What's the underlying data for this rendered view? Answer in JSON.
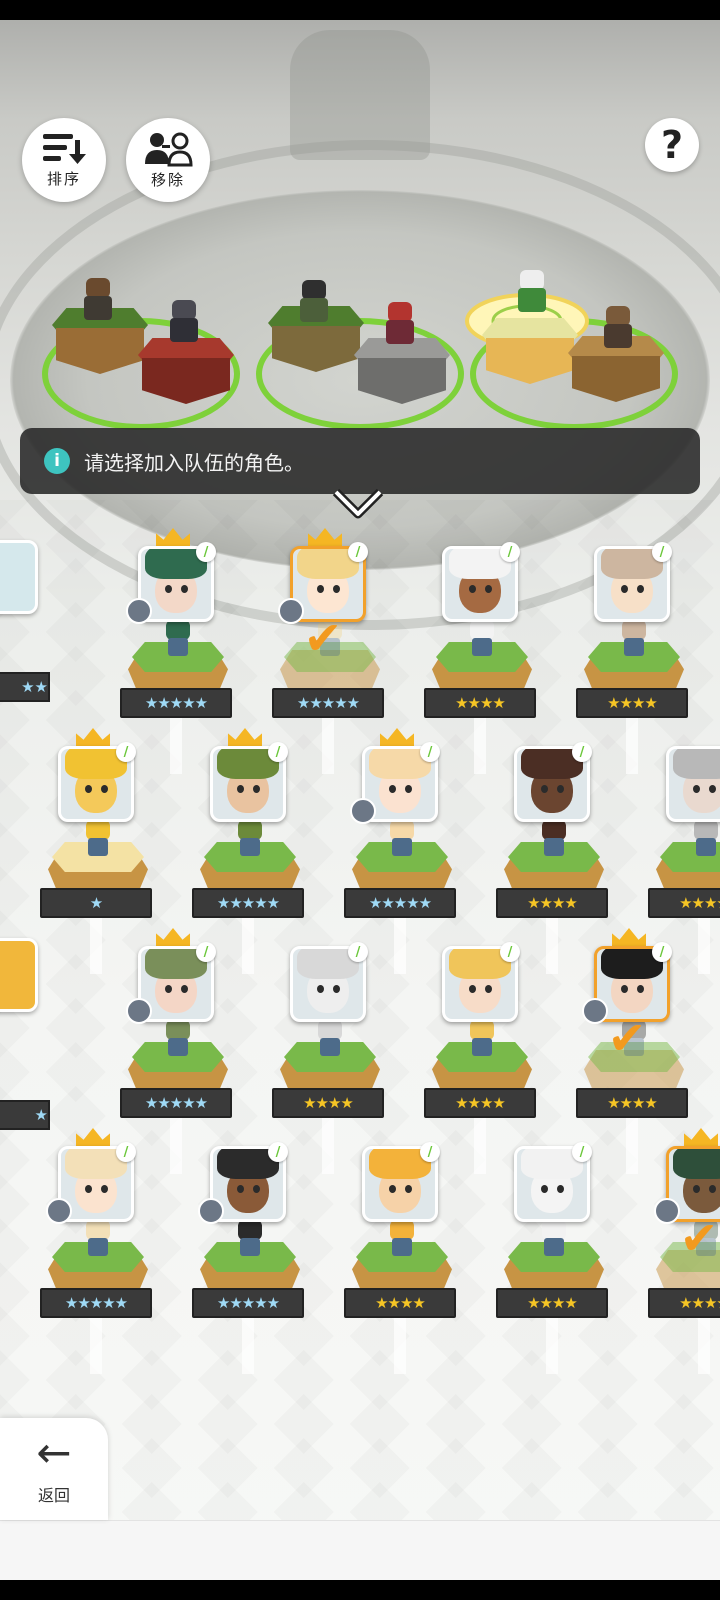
{
  "toolbar": {
    "sort_label": "排序",
    "remove_label": "移除",
    "help_glyph": "?"
  },
  "banner": {
    "info_glyph": "i",
    "message": "请选择加入队伍的角色。"
  },
  "nav": {
    "back_label": "返回",
    "back_glyph": "←"
  },
  "colors": {
    "grass": "#79b94a",
    "selected_border": "#f2a12b",
    "crown": "#f5b623",
    "star_gold": "#f5c525",
    "check": "#f29a1f",
    "banner_bg": "#282828"
  },
  "heroes": [
    {
      "row": 1,
      "col": 0,
      "stars": "★★★★★",
      "rainbow": true,
      "crown": true,
      "equip": true,
      "selected": false
    },
    {
      "row": 1,
      "col": 1,
      "stars": "★★★★★",
      "rainbow": true,
      "crown": true,
      "equip": true,
      "selected": true
    },
    {
      "row": 1,
      "col": 2,
      "stars": "★★★★",
      "rainbow": false,
      "crown": false,
      "equip": false,
      "selected": false
    },
    {
      "row": 1,
      "col": 3,
      "stars": "★★★★",
      "rainbow": false,
      "crown": false,
      "equip": false,
      "selected": false
    },
    {
      "row": 2,
      "col": 0,
      "stars": "★",
      "rainbow": true,
      "crown": true,
      "equip": false,
      "selected": false
    },
    {
      "row": 2,
      "col": 1,
      "stars": "★★★★★",
      "rainbow": true,
      "crown": true,
      "equip": false,
      "selected": false
    },
    {
      "row": 2,
      "col": 2,
      "stars": "★★★★★",
      "rainbow": true,
      "crown": true,
      "equip": true,
      "selected": false
    },
    {
      "row": 2,
      "col": 3,
      "stars": "★★★★",
      "rainbow": false,
      "crown": false,
      "equip": false,
      "selected": false
    },
    {
      "row": 2,
      "col": 4,
      "stars": "★★★★",
      "rainbow": false,
      "crown": false,
      "equip": false,
      "selected": false
    },
    {
      "row": 3,
      "col": 0,
      "stars": "★★★★★",
      "rainbow": true,
      "crown": true,
      "equip": true,
      "selected": false
    },
    {
      "row": 3,
      "col": 1,
      "stars": "★★★★",
      "rainbow": false,
      "crown": false,
      "equip": false,
      "selected": false
    },
    {
      "row": 3,
      "col": 2,
      "stars": "★★★★",
      "rainbow": false,
      "crown": false,
      "equip": false,
      "selected": false
    },
    {
      "row": 3,
      "col": 3,
      "stars": "★★★★",
      "rainbow": false,
      "crown": true,
      "equip": true,
      "selected": true
    },
    {
      "row": 4,
      "col": 0,
      "stars": "★★★★★",
      "rainbow": true,
      "crown": true,
      "equip": true,
      "selected": false
    },
    {
      "row": 4,
      "col": 1,
      "stars": "★★★★★",
      "rainbow": true,
      "crown": false,
      "equip": true,
      "selected": false
    },
    {
      "row": 4,
      "col": 2,
      "stars": "★★★★",
      "rainbow": false,
      "crown": false,
      "equip": false,
      "selected": false
    },
    {
      "row": 4,
      "col": 3,
      "stars": "★★★★",
      "rainbow": false,
      "crown": false,
      "equip": false,
      "selected": false
    },
    {
      "row": 4,
      "col": 4,
      "stars": "★★★★",
      "rainbow": false,
      "crown": true,
      "equip": true,
      "selected": true
    }
  ]
}
